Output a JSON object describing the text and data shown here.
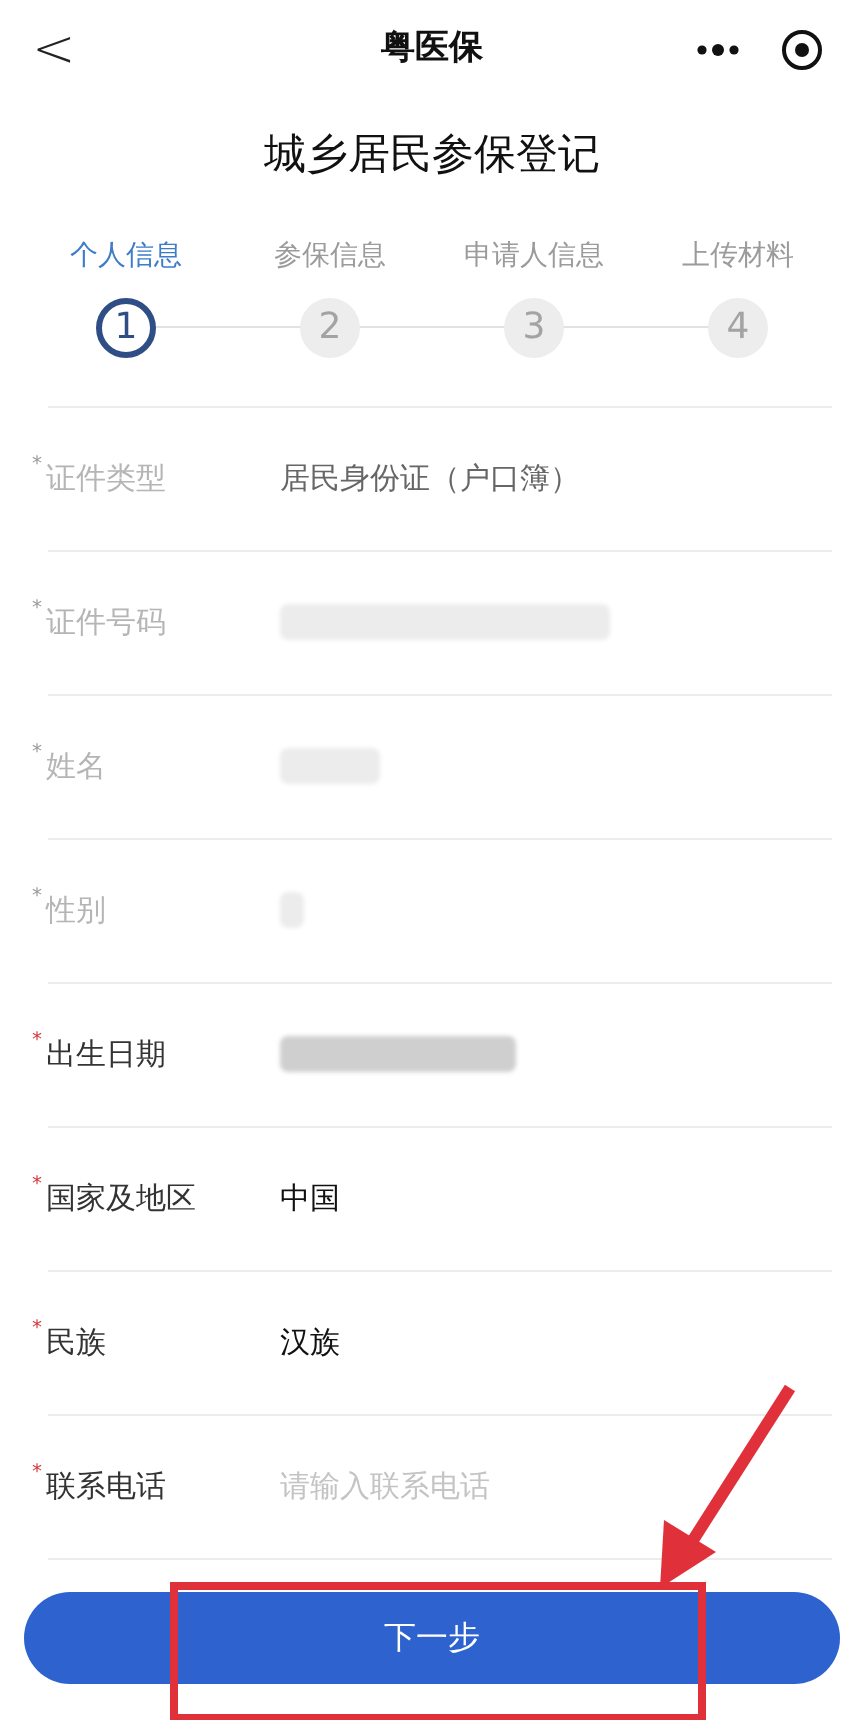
{
  "nav_bar": {
    "back": "<",
    "title": "粤医保"
  },
  "page_title": "城乡居民参保登记",
  "steps": [
    {
      "label": "个人信息",
      "number": "1",
      "selected": true
    },
    {
      "label": "参保信息",
      "number": "2",
      "selected": false
    },
    {
      "label": "申请人信息",
      "number": "3",
      "selected": false
    },
    {
      "label": "上传材料",
      "number": "4",
      "selected": false
    }
  ],
  "fields": [
    {
      "label": "证件类型",
      "mark": "*",
      "disabled": true,
      "kind": "text",
      "value": "居民身份证（户口簿）"
    },
    {
      "label": "证件号码",
      "mark": "*",
      "disabled": true,
      "kind": "redacted"
    },
    {
      "label": "姓名",
      "mark": "*",
      "disabled": true,
      "kind": "redacted"
    },
    {
      "label": "性别",
      "mark": "*",
      "disabled": true,
      "kind": "redacted"
    },
    {
      "label": "出生日期",
      "mark": "*",
      "disabled": false,
      "kind": "redacted"
    },
    {
      "label": "国家及地区",
      "mark": "*",
      "disabled": false,
      "kind": "text",
      "value": "中国"
    },
    {
      "label": "民族",
      "mark": "*",
      "disabled": false,
      "kind": "text",
      "value": "汉族"
    },
    {
      "label": "联系电话",
      "mark": "*",
      "disabled": false,
      "kind": "input",
      "placeholder": "请输入联系电话"
    }
  ],
  "next_button": "下一步"
}
